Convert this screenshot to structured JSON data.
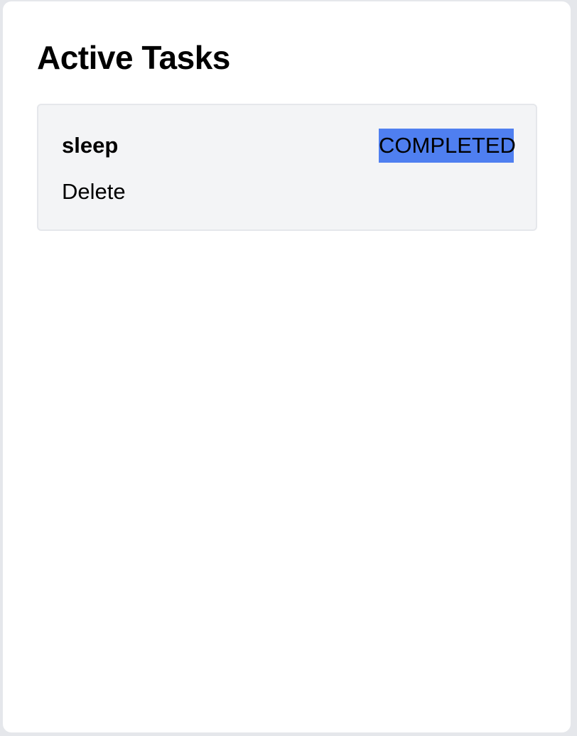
{
  "panel": {
    "title": "Active Tasks"
  },
  "tasks": [
    {
      "name": "sleep",
      "status": "COMPLETED",
      "delete_label": "Delete"
    }
  ],
  "colors": {
    "status_completed": "#4f7ff0",
    "card_background": "#f3f4f6",
    "page_background": "#e5e7eb"
  }
}
